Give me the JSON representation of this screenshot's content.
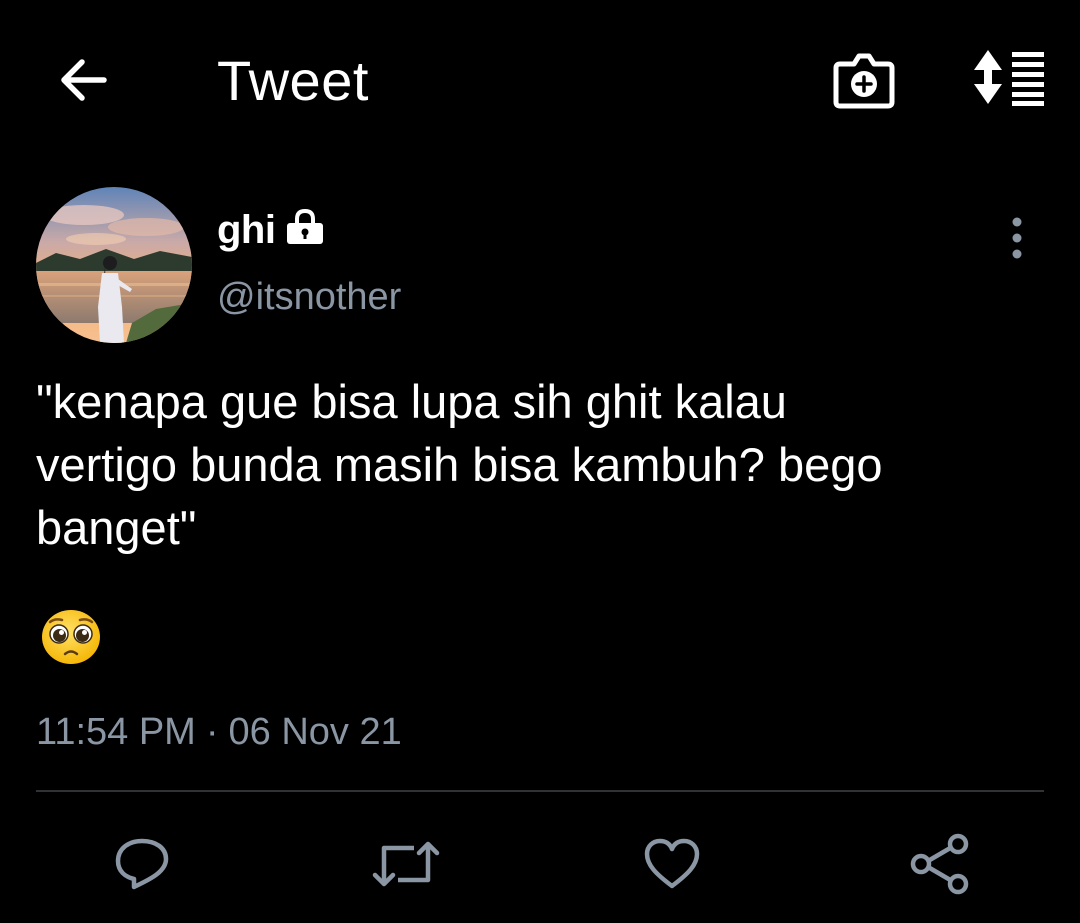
{
  "header": {
    "title": "Tweet",
    "back_icon": "arrow-left-icon",
    "camera_icon": "camera-plus-icon",
    "sort_icon": "sort-list-icon"
  },
  "author": {
    "display_name": "ghi",
    "handle": "@itsnother",
    "protected_icon": "lock-icon",
    "more_icon": "more-vertical-icon"
  },
  "tweet": {
    "text": "\"kenapa gue bisa lupa sih ghit kalau\nvertigo bunda masih bisa kambuh? bego\nbanget\"",
    "emoji": "🥺",
    "time": "11:54 PM",
    "separator": "·",
    "date": "06 Nov 21"
  },
  "actions": {
    "reply_icon": "reply-icon",
    "retweet_icon": "retweet-icon",
    "like_icon": "heart-icon",
    "share_icon": "share-icon"
  },
  "colors": {
    "background": "#000000",
    "text_primary": "#ffffff",
    "text_secondary": "#8a96a3",
    "divider": "#2f3336"
  }
}
